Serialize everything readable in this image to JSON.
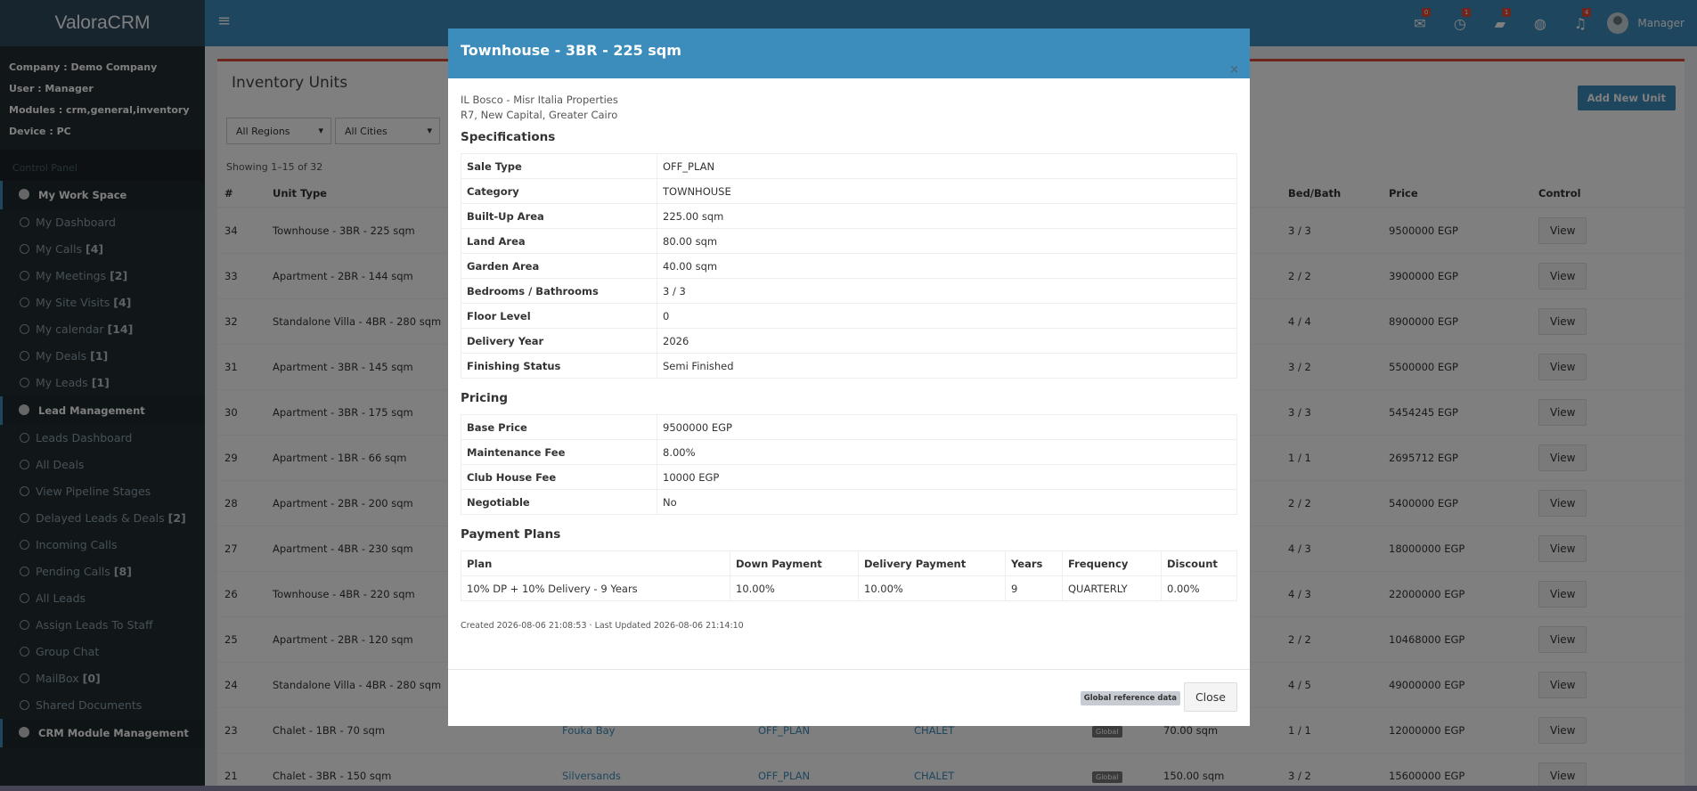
{
  "header": {
    "brand": "ValoraCRM",
    "hamburger": "≡",
    "icons": [
      {
        "icon": "envelope-icon",
        "glyph": "✉",
        "badge": "0"
      },
      {
        "icon": "clock-icon",
        "glyph": "◷",
        "badge": "1"
      },
      {
        "icon": "briefcase-icon",
        "glyph": "▰",
        "badge": "1"
      },
      {
        "icon": "globe-icon",
        "glyph": "◍",
        "badge": ""
      },
      {
        "icon": "bell-icon",
        "glyph": "♫",
        "badge": "4"
      }
    ],
    "user": "Manager"
  },
  "sidebar": {
    "info": {
      "company": "Company : Demo Company",
      "user": "User : Manager",
      "modules": "Modules : crm,general,inventory",
      "device": "Device : PC"
    },
    "control_panel": "Control Panel",
    "workspace": {
      "title": "My Work Space",
      "items": [
        {
          "label": "My Dashboard",
          "count": ""
        },
        {
          "label": "My Calls",
          "count": "[4]"
        },
        {
          "label": "My Meetings",
          "count": "[2]"
        },
        {
          "label": "My Site Visits",
          "count": "[4]"
        },
        {
          "label": "My calendar",
          "count": "[14]"
        },
        {
          "label": "My Deals",
          "count": "[1]"
        },
        {
          "label": "My Leads",
          "count": "[1]"
        }
      ]
    },
    "lead_mgmt": {
      "title": "Lead Management",
      "items": [
        {
          "label": "Leads Dashboard",
          "count": ""
        },
        {
          "label": "All Deals",
          "count": ""
        },
        {
          "label": "View Pipeline Stages",
          "count": ""
        },
        {
          "label": "Delayed Leads & Deals",
          "count": "[2]"
        },
        {
          "label": "Incoming Calls",
          "count": ""
        },
        {
          "label": "Pending Calls",
          "count": "[8]"
        },
        {
          "label": "All Leads",
          "count": ""
        },
        {
          "label": "Assign Leads To Staff",
          "count": ""
        },
        {
          "label": "Group Chat",
          "count": ""
        },
        {
          "label": "MailBox",
          "count": "[0]"
        },
        {
          "label": "Shared Documents",
          "count": ""
        }
      ]
    },
    "crm_module": {
      "title": "CRM Module Management"
    }
  },
  "page": {
    "title": "Inventory Units",
    "add_button": "Add New Unit",
    "filters": {
      "region": "All Regions",
      "city": "All Cities"
    },
    "showing": "Showing 1–15 of 32",
    "columns": {
      "num": "#",
      "unit_type": "Unit Type",
      "bed_bath": "Bed/Bath",
      "price": "Price",
      "control": "Control"
    },
    "view_label": "View",
    "global_label": "Global",
    "rows": [
      {
        "num": "34",
        "type": "Townhouse - 3BR - 225 sqm",
        "bb": "3 / 3",
        "price": "9500000 EGP"
      },
      {
        "num": "33",
        "type": "Apartment - 2BR - 144 sqm",
        "bb": "2 / 2",
        "price": "3900000 EGP"
      },
      {
        "num": "32",
        "type": "Standalone Villa - 4BR - 280 sqm",
        "bb": "4 / 4",
        "price": "8900000 EGP"
      },
      {
        "num": "31",
        "type": "Apartment - 3BR - 145 sqm",
        "bb": "3 / 2",
        "price": "5500000 EGP"
      },
      {
        "num": "30",
        "type": "Apartment - 3BR - 175 sqm",
        "bb": "3 / 3",
        "price": "5454245 EGP"
      },
      {
        "num": "29",
        "type": "Apartment - 1BR - 66 sqm",
        "bb": "1 / 1",
        "price": "2695712 EGP"
      },
      {
        "num": "28",
        "type": "Apartment - 2BR - 200 sqm",
        "bb": "2 / 2",
        "price": "5400000 EGP"
      },
      {
        "num": "27",
        "type": "Apartment - 4BR - 230 sqm",
        "bb": "4 / 3",
        "price": "18000000 EGP"
      },
      {
        "num": "26",
        "type": "Townhouse - 4BR - 220 sqm",
        "bb": "4 / 3",
        "price": "22000000 EGP"
      },
      {
        "num": "25",
        "type": "Apartment - 2BR - 120 sqm",
        "bb": "2 / 2",
        "price": "10468000 EGP"
      },
      {
        "num": "24",
        "type": "Standalone Villa - 4BR - 280 sqm",
        "bb": "4 / 5",
        "price": "49000000 EGP"
      },
      {
        "num": "23",
        "type": "Chalet - 1BR - 70 sqm",
        "project": "Fouka Bay",
        "sale": "OFF_PLAN",
        "cat": "CHALET",
        "global": true,
        "area": "70.00 sqm",
        "bb": "1 / 1",
        "price": "12000000 EGP"
      },
      {
        "num": "21",
        "type": "Chalet - 3BR - 150 sqm",
        "project": "Silversands",
        "sale": "OFF_PLAN",
        "cat": "CHALET",
        "global": true,
        "area": "150.00 sqm",
        "bb": "3 / 2",
        "price": "15600000 EGP"
      }
    ]
  },
  "modal": {
    "title": "Townhouse - 3BR - 225 sqm",
    "close_x": "×",
    "project": "IL Bosco - Misr Italia Properties",
    "location": "R7, New Capital, Greater Cairo",
    "spec_title": "Specifications",
    "specs": [
      {
        "k": "Sale Type",
        "v": "OFF_PLAN"
      },
      {
        "k": "Category",
        "v": "TOWNHOUSE"
      },
      {
        "k": "Built-Up Area",
        "v": "225.00 sqm"
      },
      {
        "k": "Land Area",
        "v": "80.00 sqm"
      },
      {
        "k": "Garden Area",
        "v": "40.00 sqm"
      },
      {
        "k": "Bedrooms / Bathrooms",
        "v": "3 / 3"
      },
      {
        "k": "Floor Level",
        "v": "0"
      },
      {
        "k": "Delivery Year",
        "v": "2026"
      },
      {
        "k": "Finishing Status",
        "v": "Semi Finished"
      }
    ],
    "pricing_title": "Pricing",
    "pricing": [
      {
        "k": "Base Price",
        "v": "9500000 EGP"
      },
      {
        "k": "Maintenance Fee",
        "v": "8.00%"
      },
      {
        "k": "Club House Fee",
        "v": "10000 EGP"
      },
      {
        "k": "Negotiable",
        "v": "No"
      }
    ],
    "plans_title": "Payment Plans",
    "plan_columns": [
      "Plan",
      "Down Payment",
      "Delivery Payment",
      "Years",
      "Frequency",
      "Discount"
    ],
    "plans": [
      [
        "10% DP + 10% Delivery - 9 Years",
        "10.00%",
        "10.00%",
        "9",
        "QUARTERLY",
        "0.00%"
      ]
    ],
    "created": "Created 2026-08-06 21:08:53 · Last Updated 2026-08-06 21:14:10",
    "ref_badge": "Global reference data",
    "close_button": "Close"
  }
}
